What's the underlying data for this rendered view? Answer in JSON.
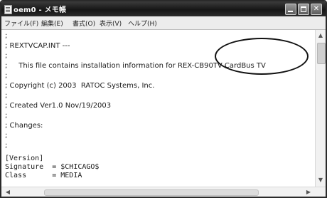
{
  "window": {
    "title": "oem0 - メモ帳",
    "controls": {
      "minimize": "",
      "maximize": "",
      "close": "✕"
    }
  },
  "menu": [
    "ファイル(F)",
    "編集(E)",
    "書式(O)",
    "表示(V)",
    "ヘルプ(H)"
  ],
  "document": {
    "lines": [
      ";",
      "; REXTVCAP.INT ---",
      ";",
      ";     This file contains installation information for REX-CB90TV CardBus TV",
      ";",
      "; Copyright (c) 2003  RATOC Systems, Inc.",
      ";",
      "; Created Ver1.0 Nov/19/2003",
      ";",
      "; Changes:",
      ";",
      ";",
      "",
      "[Version]",
      "Signature  = $CHICAGO$",
      "Class      = MEDIA"
    ]
  },
  "scrollbars": {
    "up_arrow": "▲",
    "down_arrow": "▼",
    "left_arrow": "◀",
    "right_arrow": "▶"
  }
}
